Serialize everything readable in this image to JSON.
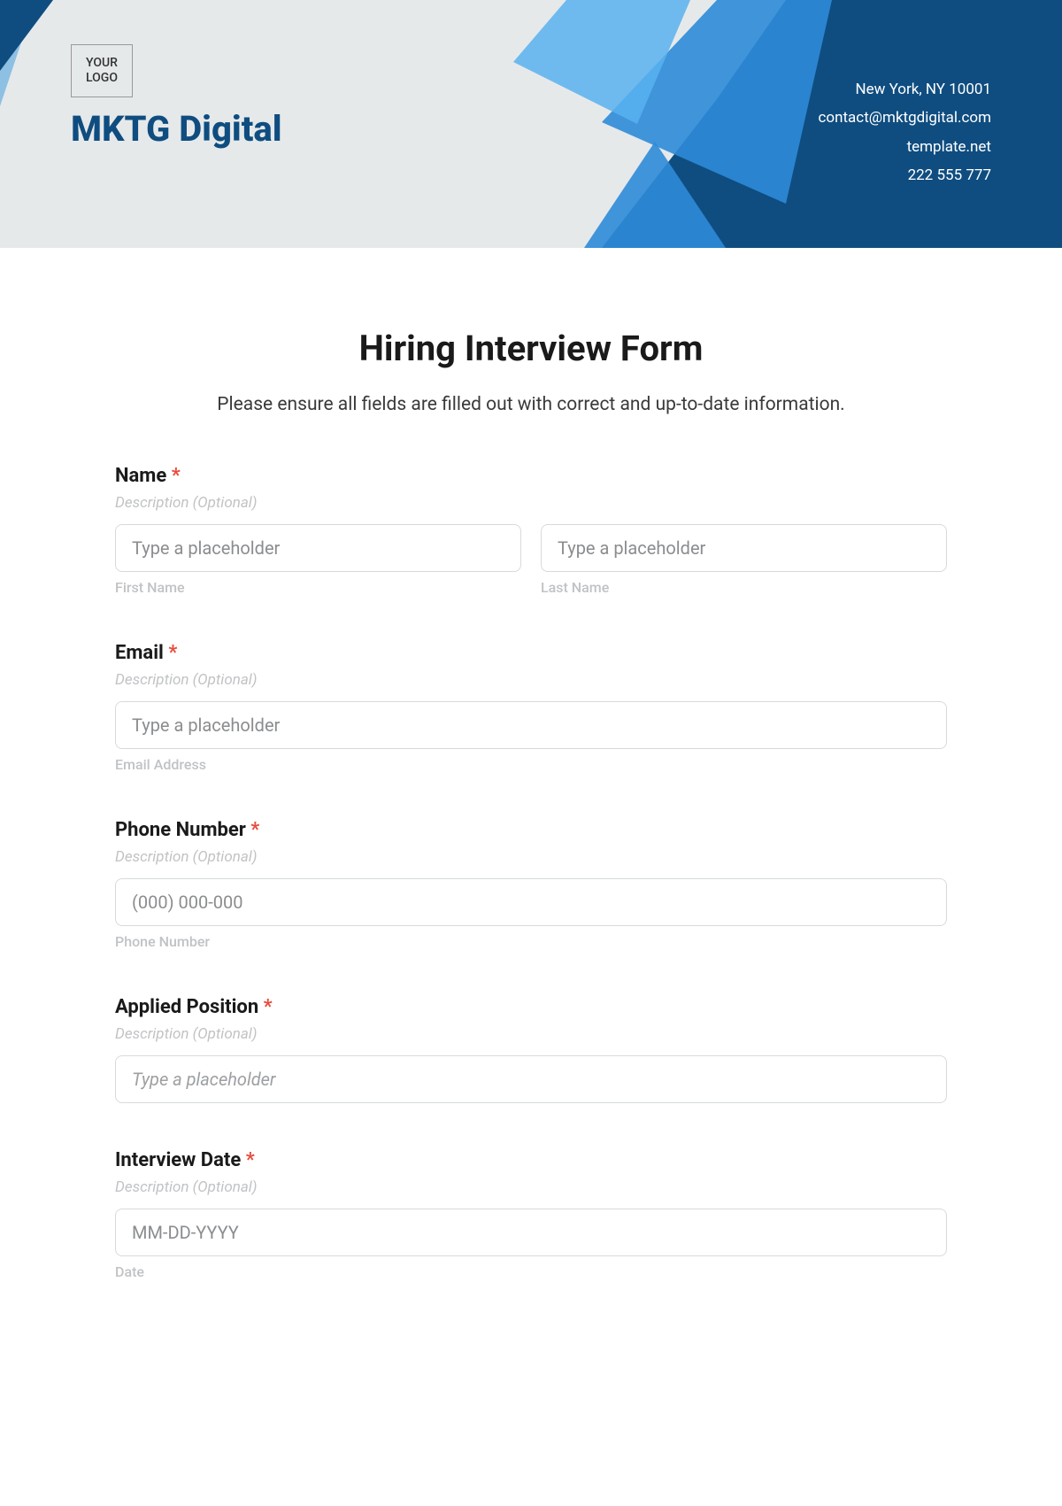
{
  "header": {
    "logo_text": "YOUR\nLOGO",
    "company_name": "MKTG Digital",
    "contact": {
      "address": "New York, NY 10001",
      "email": "contact@mktgdigital.com",
      "site": "template.net",
      "phone": "222 555 777"
    }
  },
  "form": {
    "title": "Hiring Interview Form",
    "intro": "Please ensure all fields are filled out with correct and up-to-date information.",
    "desc_placeholder": "Description (Optional)",
    "fields": {
      "name": {
        "label": "Name",
        "first_ph": "Type a placeholder",
        "first_sub": "First Name",
        "last_ph": "Type a placeholder",
        "last_sub": "Last Name"
      },
      "email": {
        "label": "Email",
        "ph": "Type a placeholder",
        "sub": "Email Address"
      },
      "phone": {
        "label": "Phone Number",
        "ph": "(000) 000-000",
        "sub": "Phone Number"
      },
      "position": {
        "label": "Applied Position",
        "ph": "Type a placeholder"
      },
      "interview_date": {
        "label": "Interview Date",
        "ph": "MM-DD-YYYY",
        "sub": "Date"
      }
    },
    "required_mark": "*"
  }
}
